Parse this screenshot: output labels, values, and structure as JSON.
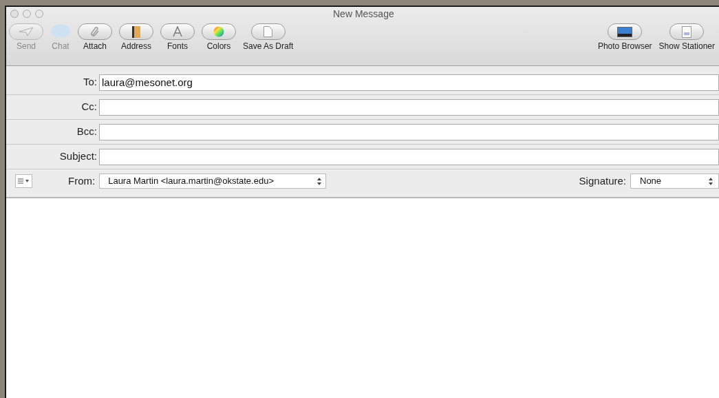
{
  "window": {
    "title": "New Message"
  },
  "toolbar": {
    "left": [
      {
        "kind": "send",
        "label": "Send",
        "disabled": true
      },
      {
        "kind": "chat",
        "label": "Chat",
        "disabled": true
      },
      {
        "kind": "attach",
        "label": "Attach",
        "disabled": false
      },
      {
        "kind": "address",
        "label": "Address",
        "disabled": false
      },
      {
        "kind": "fonts",
        "label": "Fonts",
        "disabled": false
      },
      {
        "kind": "colors",
        "label": "Colors",
        "disabled": false
      },
      {
        "kind": "draft",
        "label": "Save As Draft",
        "disabled": false
      }
    ],
    "right": [
      {
        "kind": "photo",
        "label": "Photo Browser",
        "disabled": false
      },
      {
        "kind": "stationery",
        "label": "Show Stationer",
        "disabled": false
      }
    ]
  },
  "fields": [
    {
      "label": "To:",
      "value": "laura@mesonet.org"
    },
    {
      "label": "Cc:"
    },
    {
      "label": "Bcc:"
    },
    {
      "label": "Subject:"
    }
  ],
  "from": {
    "label": "From:",
    "value": "Laura Martin <laura.martin@okstate.edu>"
  },
  "signature": {
    "label": "Signature:",
    "value": "None"
  }
}
